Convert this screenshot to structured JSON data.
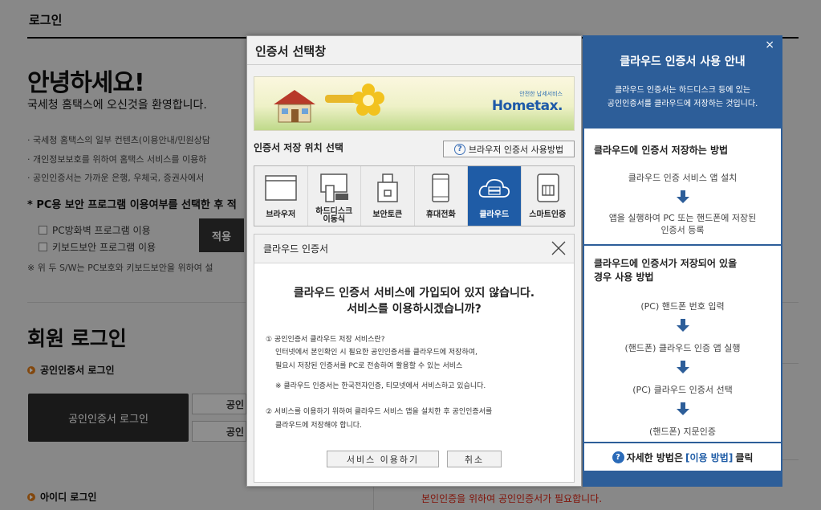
{
  "background": {
    "header_title": "로그인",
    "hello": "안녕하세요!",
    "welcome": "국세청 홈택스에 오신것을 환영합니다.",
    "notes": [
      "국세청 홈택스의 일부 컨텐츠(이용안내/민원상담",
      "개인정보보호를 위하여 홈택스 서비스를 이용하",
      "공인인증서는 가까운 은행, 우체국, 증권사에서 "
    ],
    "select_title": "* PC용 보안 프로그램 이용여부를 선택한 후 적",
    "check_firewall": "PC방화벽 프로그램 이용",
    "check_keyboard": "키보드보안 프로그램 이용",
    "apply_label": "적용",
    "sw_note": "※ 위 두 S/W는 PC보호와 키보드보안을 위하여 설",
    "member_login": "회원 로그인",
    "cert_login_bullet": "공인인증서 로그인",
    "cert_login_button": "공인인증서 로그인",
    "small_btn_1": "공인",
    "small_btn_2": "공인",
    "id_login_bullet": "아이디 로그인",
    "red_note": "본인인증을 위하여 공인인증서가 필요합니다."
  },
  "modal": {
    "title": "인증서 선택창",
    "banner_brand_small": "안전한 납세서비스",
    "banner_brand": "Hometax.",
    "location_label": "인증서 저장 위치 선택",
    "guide_button": "브라우저 인증서 사용방법",
    "devices": [
      {
        "label": "브라우저",
        "icon": "browser-icon"
      },
      {
        "label": "하드디스크\n이동식",
        "icon": "harddisk-icon"
      },
      {
        "label": "보안토큰",
        "icon": "security-token-icon"
      },
      {
        "label": "휴대전화",
        "icon": "mobile-phone-icon"
      },
      {
        "label": "클라우드",
        "icon": "cloud-icon",
        "active": true
      },
      {
        "label": "스마트인증",
        "icon": "smart-auth-icon"
      }
    ]
  },
  "cloud_dialog": {
    "title": "클라우드 인증서",
    "question_1": "클라우드 인증서 서비스에 가입되어 있지 않습니다.",
    "question_2": "서비스를 이용하시겠습니까?",
    "info_1_title": "① 공인인증서 클라우드 저장 서비스란?",
    "info_1_line_1": "인터넷에서 본인확인 시 필요한 공인인증서를 클라우드에 저장하여,",
    "info_1_line_2": "필요시 저장된 인증서를 PC로 전송하여 활용할 수 있는 서비스",
    "info_1_note": "※ 클라우드 인증서는 한국전자인증, 티모넷에서 서비스하고 있습니다.",
    "info_2_line_1": "② 서비스를 이용하기 위하여 클라우드 서비스 앱을 설치한 후 공인인증서를",
    "info_2_line_2": "클라우드에 저장해야 합니다.",
    "use_button": "서비스 이용하기",
    "cancel_button": "취소"
  },
  "guide": {
    "close": "×",
    "title": "클라우드 인증서 사용 안내",
    "desc_1": "클라우드 인증서는 하드디스크 등에 있는",
    "desc_2": "공인인증서를 클라우드에 저장하는 것입니다.",
    "section_1_title": "클라우드에 인증서 저장하는 방법",
    "section_1_step_1": "클라우드 인증 서비스 앱 설치",
    "section_1_step_2a": "앱을 실행하여 PC 또는 핸드폰에 저장된",
    "section_1_step_2b": "인증서 등록",
    "section_2_title_a": "클라우드에 인증서가 저장되어 있을",
    "section_2_title_b": "경우 사용 방법",
    "section_2_steps": [
      "(PC) 핸드폰 번호 입력",
      "(핸드폰) 클라우드 인증 앱 실행",
      "(PC) 클라우드 인증서 선택",
      "(핸드폰) 지문인증"
    ],
    "foot_text": "자세한 방법은",
    "foot_link": "[이용 방법]",
    "foot_suffix": "클릭"
  },
  "colors": {
    "guide_panel": "#2d5e99",
    "active_device": "#1f5ca6",
    "bullet_orange": "#e07b17",
    "red_note": "#dd2211"
  }
}
